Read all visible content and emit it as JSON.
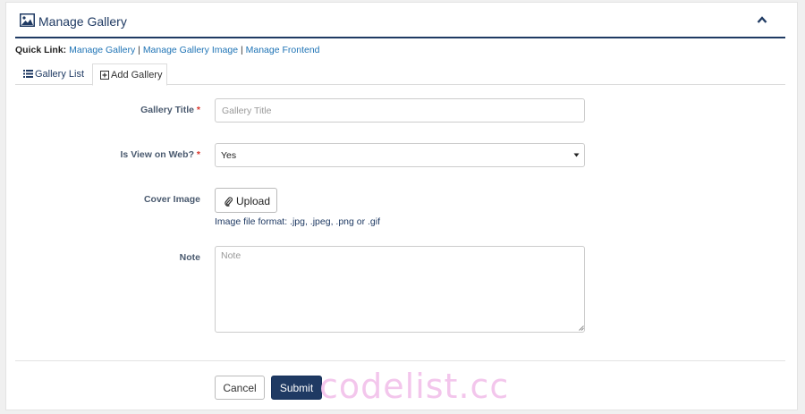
{
  "header": {
    "title": "Manage Gallery",
    "icon": "image-gallery-icon",
    "collapse_icon": "chevron-up-icon",
    "accent_color": "#1f3a63"
  },
  "quick_links": {
    "label": "Quick Link:",
    "items": [
      "Manage Gallery",
      "Manage Gallery Image",
      "Manage Frontend"
    ],
    "separator": "|",
    "link_color": "#1e73b5"
  },
  "tabs": [
    {
      "label": "Gallery List",
      "icon": "list-icon",
      "active": false
    },
    {
      "label": "Add Gallery",
      "icon": "plus-square-icon",
      "active": true
    }
  ],
  "form": {
    "gallery_title": {
      "label": "Gallery Title",
      "required_mark": "*",
      "placeholder": "Gallery Title",
      "value": ""
    },
    "view_on_web": {
      "label": "Is View on Web?",
      "required_mark": "*",
      "selected": "Yes"
    },
    "cover_image": {
      "label": "Cover Image",
      "button_label": "Upload",
      "button_icon": "paperclip-icon",
      "hint": "Image file format: .jpg, .jpeg, .png or .gif"
    },
    "note": {
      "label": "Note",
      "placeholder": "Note",
      "value": ""
    }
  },
  "actions": {
    "cancel_label": "Cancel",
    "submit_label": "Submit",
    "submit_color": "#1f3a63"
  },
  "watermark": "codelist.cc"
}
